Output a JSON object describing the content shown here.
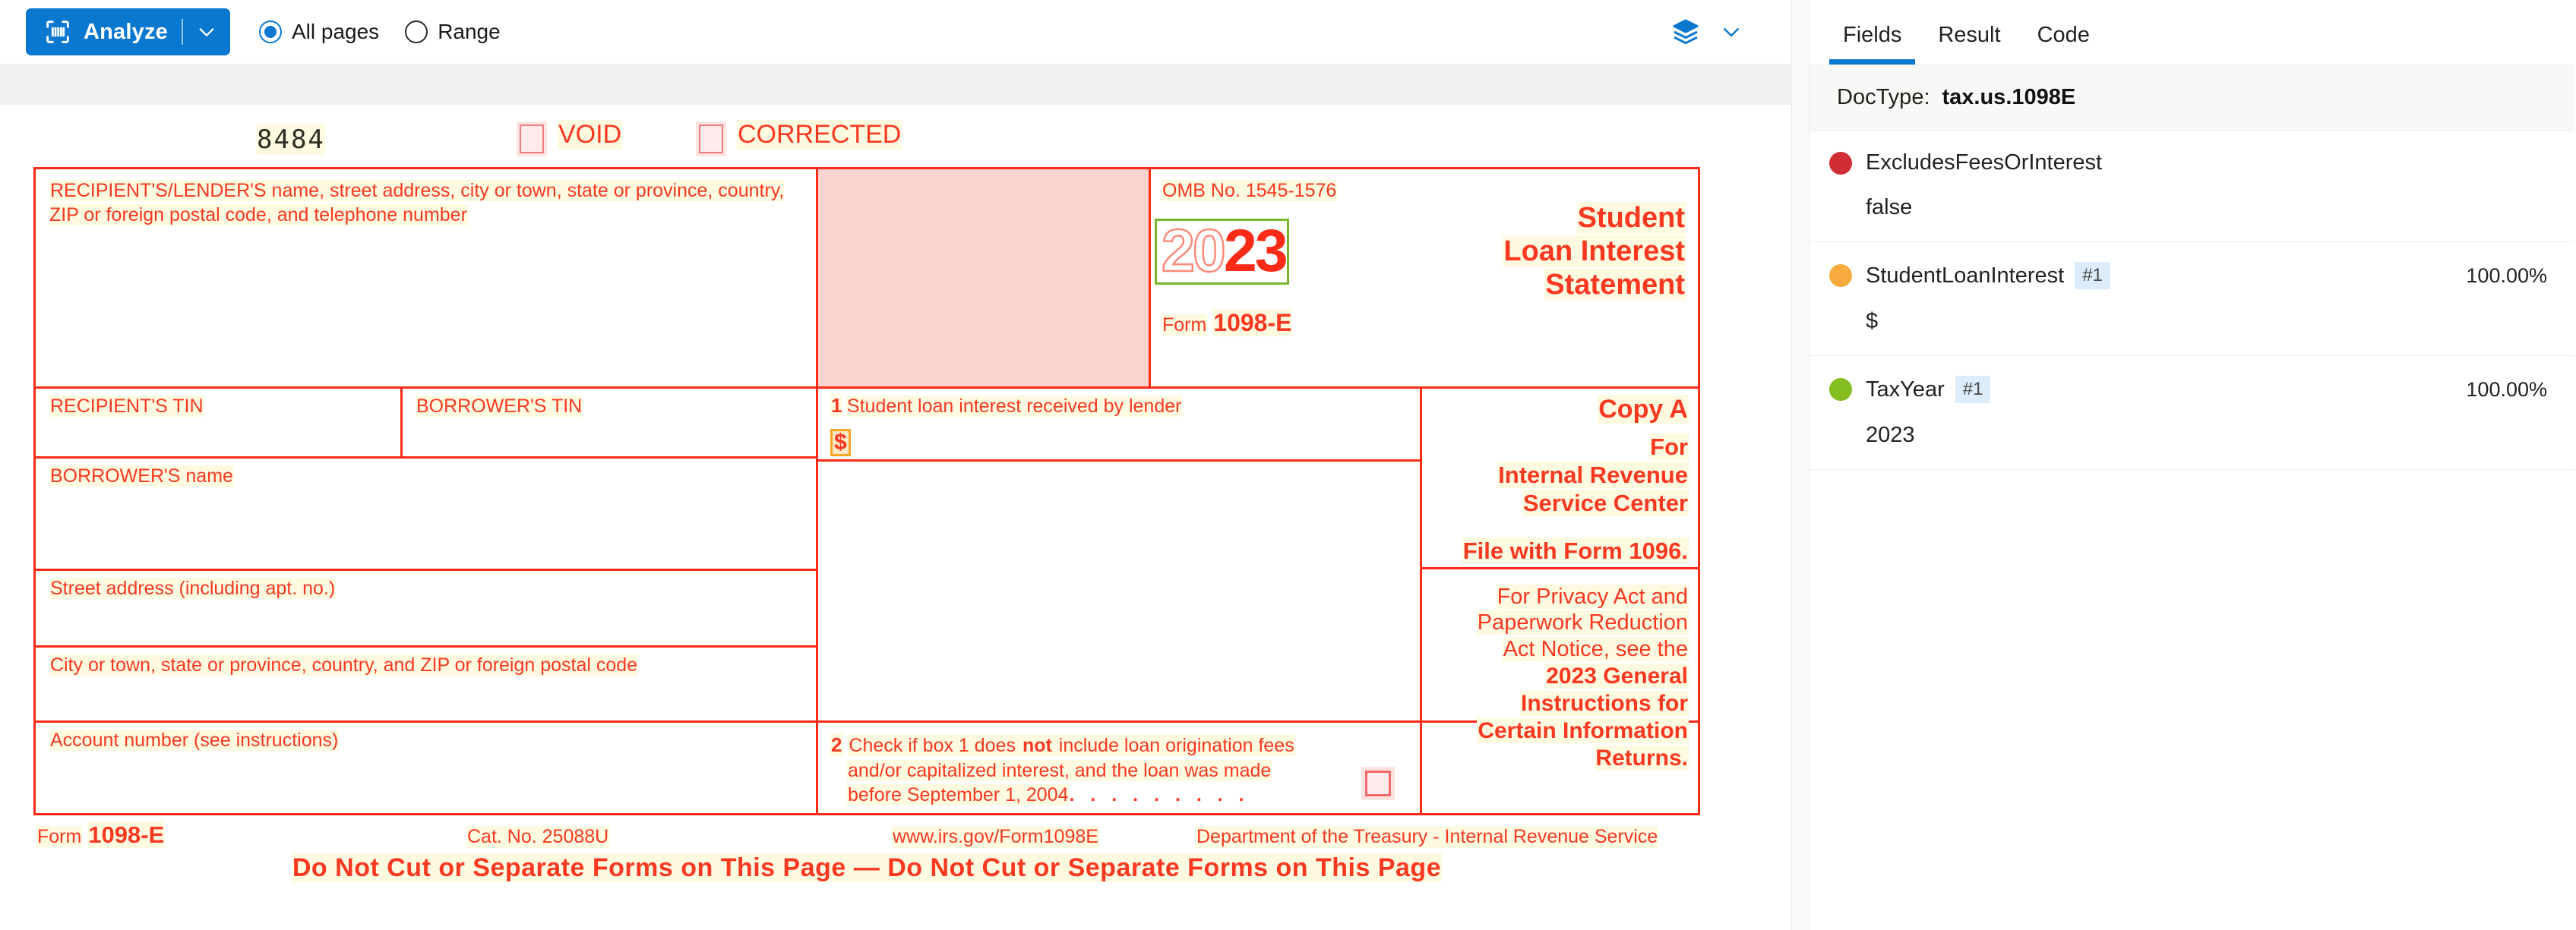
{
  "toolbar": {
    "analyze_label": "Analyze",
    "analyze_icon": "document-scan-icon",
    "caret_icon": "chevron-down-icon",
    "layers_icon": "layers-icon",
    "layers_caret_icon": "chevron-down-icon",
    "radio_options": [
      {
        "label": "All pages",
        "selected": true
      },
      {
        "label": "Range",
        "selected": false
      }
    ],
    "accent_color": "#0b78d0"
  },
  "document": {
    "form_number_stamp": "8484",
    "checkboxes": [
      {
        "label": "VOID",
        "checked": false
      },
      {
        "label": "CORRECTED",
        "checked": false
      }
    ],
    "recipient_block_label": "RECIPIENT'S/LENDER'S name, street address, city or town, state or province, country, ZIP or foreign postal code, and telephone number",
    "omb_label": "OMB No. 1545-1576",
    "year_prefix": "20",
    "year_suffix": "23",
    "form_word": "Form",
    "form_id": "1098-E",
    "title_line1": "Student",
    "title_line2": "Loan Interest",
    "title_line3": "Statement",
    "recipient_tin_label": "RECIPIENT'S TIN",
    "borrower_tin_label": "BORROWER'S TIN",
    "borrower_name_label": "BORROWER'S name",
    "street_label": "Street address (including apt. no.)",
    "city_label": "City or town, state or province, country, and ZIP or foreign postal code",
    "account_label": "Account number (see instructions)",
    "box1_num": "1",
    "box1_label": "Student loan interest received by lender",
    "box1_currency": "$",
    "box2_num": "2",
    "box2_line1_a": "Check if box 1 does ",
    "box2_line1_b": "not",
    "box2_line1_c": " include loan origination fees",
    "box2_line2": "and/or capitalized interest, and the loan was made",
    "box2_line3": "before September 1, 2004",
    "box2_leader": ".   .   .   .   .   .   .   .   .",
    "copy_a": "Copy A",
    "copy_for": "For",
    "copy_irs1": "Internal Revenue",
    "copy_irs2": "Service Center",
    "copy_file": "File with Form 1096.",
    "privacy_1": "For Privacy Act and",
    "privacy_2": "Paperwork Reduction",
    "privacy_3": "Act Notice, see the",
    "privacy_4": "2023 General",
    "privacy_5": "Instructions for",
    "privacy_6": "Certain Information",
    "privacy_7": "Returns.",
    "footer_form_word": "Form",
    "footer_form_id": "1098-E",
    "footer_cat": "Cat. No. 25088U",
    "footer_url": "www.irs.gov/Form1098E",
    "footer_dept": "Department of the Treasury - Internal Revenue Service",
    "do_not_cut": "Do Not Cut or Separate Forms on This Page — Do Not Cut or Separate Forms on This Page",
    "ink_color": "#f93822",
    "pink_fill": "#fbd4d0",
    "ocr_highlight": "#fdfae0",
    "taxyear_box_color": "#76b82a",
    "currency_box_color": "#f5a623"
  },
  "panel": {
    "tabs": [
      {
        "label": "Fields",
        "active": true
      },
      {
        "label": "Result",
        "active": false
      },
      {
        "label": "Code",
        "active": false
      }
    ],
    "doctype_key": "DocType:",
    "doctype_value": "tax.us.1098E",
    "fields": [
      {
        "name": "ExcludesFeesOrInterest",
        "badge": "",
        "confidence": "",
        "value": "false",
        "color": "#cf2f34"
      },
      {
        "name": "StudentLoanInterest",
        "badge": "#1",
        "confidence": "100.00%",
        "value": "$",
        "color": "#f7ab3e"
      },
      {
        "name": "TaxYear",
        "badge": "#1",
        "confidence": "100.00%",
        "value": "2023",
        "color": "#84bd21"
      }
    ]
  }
}
